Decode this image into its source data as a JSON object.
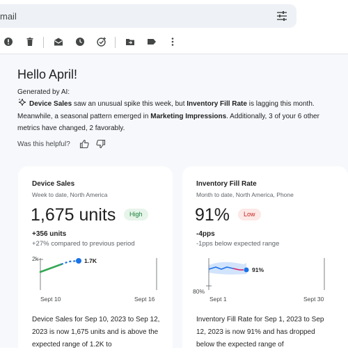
{
  "search": {
    "text": "mail"
  },
  "toolbar": {
    "icons": [
      "report-spam-icon",
      "delete-icon",
      "mark-as-read-icon",
      "snooze-icon",
      "add-to-tasks-icon",
      "move-to-icon",
      "label-icon",
      "more-icon"
    ]
  },
  "summary": {
    "greeting": "Hello April!",
    "ai_label": "Generated by AI:",
    "text_1": " saw an unusual spike this week, but ",
    "text_2": " is lagging this month. Meanwhile, a seasonal pattern emerged in ",
    "text_3": ". Additionally, 3 of your 6 other metrics have changed, 2 favorably.",
    "metric_1": "Device Sales",
    "metric_2": "Inventory Fill Rate",
    "metric_3": "Marketing Impressions",
    "feedback_prompt": "Was this helpful?"
  },
  "cards": [
    {
      "title": "Device Sales",
      "subtitle": "Week to date, North America",
      "value": "1,675 units",
      "badge": "High",
      "delta": "+356 units",
      "delta_desc": "+27% compared to previous period",
      "body": "Device Sales for Sep 10, 2023 to Sep 12, 2023 is now 1,675 units and is above the expected range of 1.2K to"
    },
    {
      "title": "Inventory Fill Rate",
      "subtitle": "Month to date, North America, Phone",
      "value": "91%",
      "badge": "Low",
      "delta": "-4pps",
      "delta_desc": "-1pps below expected range",
      "body": "Inventory Fill Rate for Sep 1, 2023 to Sep 12, 2023 is now 91% and has dropped below the expected range of"
    }
  ],
  "chart_data": [
    {
      "type": "line",
      "y_tick_labels": [
        "2k"
      ],
      "x_tick_labels": [
        "Sept 10",
        "Sept 16"
      ],
      "series": [
        {
          "x": [
            "Sept 10",
            "Sept 11",
            "Sept 12"
          ],
          "values": [
            1400,
            1550,
            1675
          ]
        }
      ],
      "annotation": "1.7K",
      "colors": {
        "actual": "#34a853",
        "projection": "#1a73e8",
        "point": "#1a73e8"
      }
    },
    {
      "type": "line",
      "y_tick_labels": [
        "80%"
      ],
      "x_tick_labels": [
        "Sept 1",
        "Sept 30"
      ],
      "series": [
        {
          "x": [
            "Sept 1",
            "Sept 4",
            "Sept 7",
            "Sept 10",
            "Sept 12"
          ],
          "values": [
            92,
            93,
            92,
            93,
            91
          ]
        }
      ],
      "annotation": "91%",
      "colors": {
        "actual": "#1a73e8",
        "below_range": "#d81b60",
        "expected_band": "#d2e3fc",
        "point": "#1a73e8"
      }
    }
  ]
}
